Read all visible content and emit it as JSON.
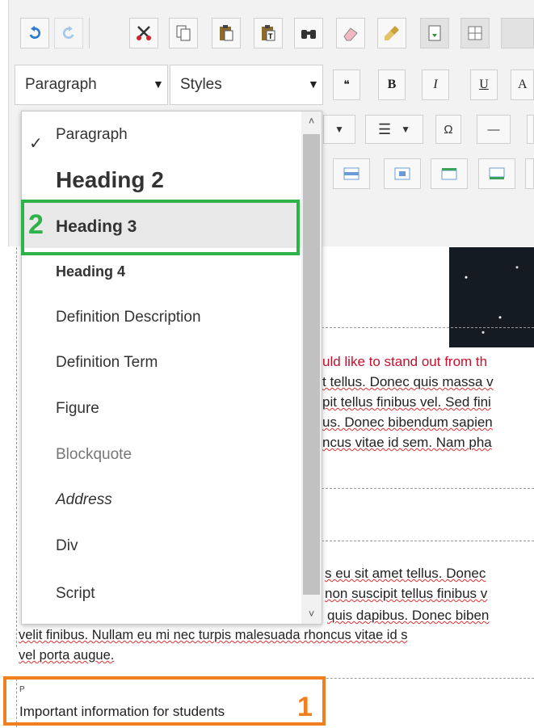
{
  "toolbar": {
    "row1_icons": [
      "undo-icon",
      "redo-icon",
      "cut-icon",
      "copy-icon",
      "paste-icon",
      "paste-text-icon",
      "find-icon",
      "eraser-icon",
      "format-painter-icon",
      "insert-file-icon",
      "table-icon"
    ],
    "paragraph_combo": "Paragraph",
    "styles_combo": "Styles",
    "quote_label": "❝",
    "bold_label": "B",
    "italic_label": "I",
    "underline_label": "U",
    "font_size_label": "A",
    "omega_label": "Ω",
    "hr_label": "—",
    "list_label": "☰"
  },
  "dropdown": {
    "selected": "Paragraph",
    "items": [
      {
        "label": "Paragraph"
      },
      {
        "label": "Heading 2"
      },
      {
        "label": "Heading 3"
      },
      {
        "label": "Heading 4"
      },
      {
        "label": "Definition Description"
      },
      {
        "label": "Definition Term"
      },
      {
        "label": "Figure"
      },
      {
        "label": "Blockquote"
      },
      {
        "label": "Address"
      },
      {
        "label": "Div"
      },
      {
        "label": "Script"
      }
    ]
  },
  "content": {
    "red_line": "uld like to stand out from th",
    "lines1": [
      "t tellus. Donec quis massa v",
      "pit tellus finibus vel. Sed fini",
      "us. Donec bibendum sapien",
      "ncus vitae id sem. Nam pha"
    ],
    "lines2": [
      "s eu sit amet tellus. Donec",
      "non suscipit tellus finibus v",
      "quis dapibus. Donec biben"
    ],
    "full_line1": "velit finibus. Nullam eu mi nec turpis malesuada rhoncus vitae id s",
    "full_line2": "vel porta augue.",
    "block_tag": "P",
    "important": "Important information for students"
  },
  "annotations": {
    "step1": "1",
    "step2": "2",
    "green": "#2db34a",
    "orange": "#f07f1f"
  }
}
